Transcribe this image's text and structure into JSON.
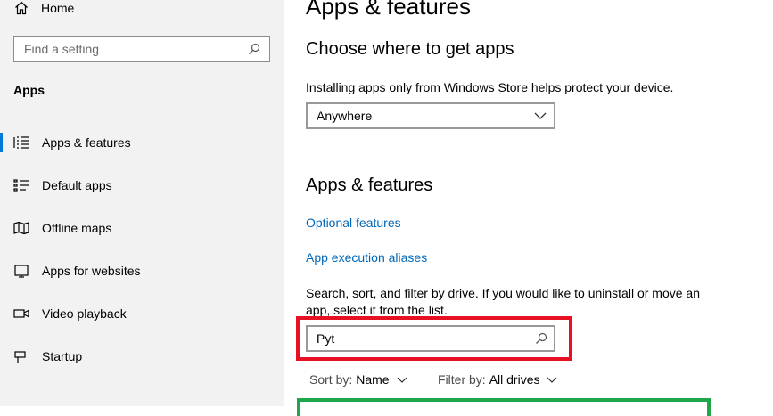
{
  "sidebar": {
    "home_label": "Home",
    "search_placeholder": "Find a setting",
    "section_title": "Apps",
    "items": [
      {
        "label": "Apps & features",
        "icon": "list-detail-icon",
        "selected": true
      },
      {
        "label": "Default apps",
        "icon": "list-check-icon",
        "selected": false
      },
      {
        "label": "Offline maps",
        "icon": "map-icon",
        "selected": false
      },
      {
        "label": "Apps for websites",
        "icon": "web-app-icon",
        "selected": false
      },
      {
        "label": "Video playback",
        "icon": "video-icon",
        "selected": false
      },
      {
        "label": "Startup",
        "icon": "startup-icon",
        "selected": false
      }
    ],
    "accent_color": "#0078d7"
  },
  "main": {
    "page_title": "Apps & features",
    "choose_heading": "Choose where to get apps",
    "choose_description": "Installing apps only from Windows Store helps protect your device.",
    "source_dropdown_value": "Anywhere",
    "apps_heading": "Apps & features",
    "optional_features_link": "Optional features",
    "aliases_link": "App execution aliases",
    "search_description": "Search, sort, and filter by drive. If you would like to uninstall or move an app, select it from the list.",
    "app_search_value": "Pyt",
    "sort_label": "Sort by:",
    "sort_value": "Name",
    "filter_label": "Filter by:",
    "filter_value": "All drives",
    "link_color": "#0067b8",
    "highlight_red": "#e81123",
    "highlight_green": "#1fa64a"
  }
}
